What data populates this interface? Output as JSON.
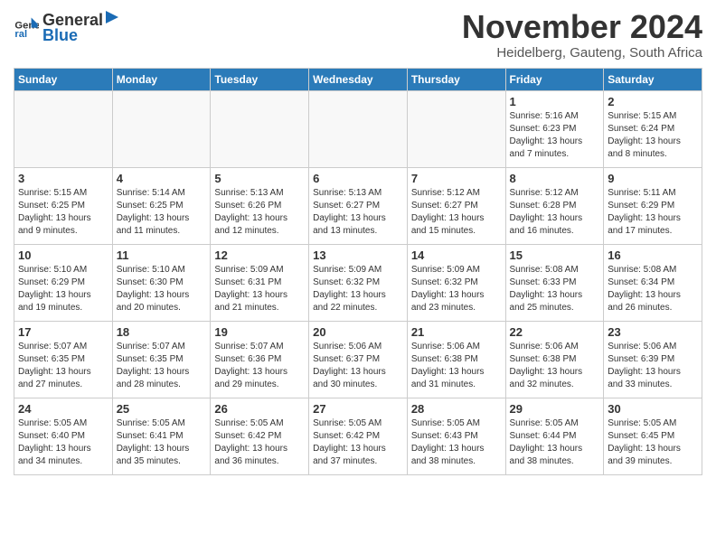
{
  "header": {
    "logo_general": "General",
    "logo_blue": "Blue",
    "month_title": "November 2024",
    "location": "Heidelberg, Gauteng, South Africa"
  },
  "weekdays": [
    "Sunday",
    "Monday",
    "Tuesday",
    "Wednesday",
    "Thursday",
    "Friday",
    "Saturday"
  ],
  "weeks": [
    [
      {
        "day": "",
        "info": ""
      },
      {
        "day": "",
        "info": ""
      },
      {
        "day": "",
        "info": ""
      },
      {
        "day": "",
        "info": ""
      },
      {
        "day": "",
        "info": ""
      },
      {
        "day": "1",
        "info": "Sunrise: 5:16 AM\nSunset: 6:23 PM\nDaylight: 13 hours and 7 minutes."
      },
      {
        "day": "2",
        "info": "Sunrise: 5:15 AM\nSunset: 6:24 PM\nDaylight: 13 hours and 8 minutes."
      }
    ],
    [
      {
        "day": "3",
        "info": "Sunrise: 5:15 AM\nSunset: 6:25 PM\nDaylight: 13 hours and 9 minutes."
      },
      {
        "day": "4",
        "info": "Sunrise: 5:14 AM\nSunset: 6:25 PM\nDaylight: 13 hours and 11 minutes."
      },
      {
        "day": "5",
        "info": "Sunrise: 5:13 AM\nSunset: 6:26 PM\nDaylight: 13 hours and 12 minutes."
      },
      {
        "day": "6",
        "info": "Sunrise: 5:13 AM\nSunset: 6:27 PM\nDaylight: 13 hours and 13 minutes."
      },
      {
        "day": "7",
        "info": "Sunrise: 5:12 AM\nSunset: 6:27 PM\nDaylight: 13 hours and 15 minutes."
      },
      {
        "day": "8",
        "info": "Sunrise: 5:12 AM\nSunset: 6:28 PM\nDaylight: 13 hours and 16 minutes."
      },
      {
        "day": "9",
        "info": "Sunrise: 5:11 AM\nSunset: 6:29 PM\nDaylight: 13 hours and 17 minutes."
      }
    ],
    [
      {
        "day": "10",
        "info": "Sunrise: 5:10 AM\nSunset: 6:29 PM\nDaylight: 13 hours and 19 minutes."
      },
      {
        "day": "11",
        "info": "Sunrise: 5:10 AM\nSunset: 6:30 PM\nDaylight: 13 hours and 20 minutes."
      },
      {
        "day": "12",
        "info": "Sunrise: 5:09 AM\nSunset: 6:31 PM\nDaylight: 13 hours and 21 minutes."
      },
      {
        "day": "13",
        "info": "Sunrise: 5:09 AM\nSunset: 6:32 PM\nDaylight: 13 hours and 22 minutes."
      },
      {
        "day": "14",
        "info": "Sunrise: 5:09 AM\nSunset: 6:32 PM\nDaylight: 13 hours and 23 minutes."
      },
      {
        "day": "15",
        "info": "Sunrise: 5:08 AM\nSunset: 6:33 PM\nDaylight: 13 hours and 25 minutes."
      },
      {
        "day": "16",
        "info": "Sunrise: 5:08 AM\nSunset: 6:34 PM\nDaylight: 13 hours and 26 minutes."
      }
    ],
    [
      {
        "day": "17",
        "info": "Sunrise: 5:07 AM\nSunset: 6:35 PM\nDaylight: 13 hours and 27 minutes."
      },
      {
        "day": "18",
        "info": "Sunrise: 5:07 AM\nSunset: 6:35 PM\nDaylight: 13 hours and 28 minutes."
      },
      {
        "day": "19",
        "info": "Sunrise: 5:07 AM\nSunset: 6:36 PM\nDaylight: 13 hours and 29 minutes."
      },
      {
        "day": "20",
        "info": "Sunrise: 5:06 AM\nSunset: 6:37 PM\nDaylight: 13 hours and 30 minutes."
      },
      {
        "day": "21",
        "info": "Sunrise: 5:06 AM\nSunset: 6:38 PM\nDaylight: 13 hours and 31 minutes."
      },
      {
        "day": "22",
        "info": "Sunrise: 5:06 AM\nSunset: 6:38 PM\nDaylight: 13 hours and 32 minutes."
      },
      {
        "day": "23",
        "info": "Sunrise: 5:06 AM\nSunset: 6:39 PM\nDaylight: 13 hours and 33 minutes."
      }
    ],
    [
      {
        "day": "24",
        "info": "Sunrise: 5:05 AM\nSunset: 6:40 PM\nDaylight: 13 hours and 34 minutes."
      },
      {
        "day": "25",
        "info": "Sunrise: 5:05 AM\nSunset: 6:41 PM\nDaylight: 13 hours and 35 minutes."
      },
      {
        "day": "26",
        "info": "Sunrise: 5:05 AM\nSunset: 6:42 PM\nDaylight: 13 hours and 36 minutes."
      },
      {
        "day": "27",
        "info": "Sunrise: 5:05 AM\nSunset: 6:42 PM\nDaylight: 13 hours and 37 minutes."
      },
      {
        "day": "28",
        "info": "Sunrise: 5:05 AM\nSunset: 6:43 PM\nDaylight: 13 hours and 38 minutes."
      },
      {
        "day": "29",
        "info": "Sunrise: 5:05 AM\nSunset: 6:44 PM\nDaylight: 13 hours and 38 minutes."
      },
      {
        "day": "30",
        "info": "Sunrise: 5:05 AM\nSunset: 6:45 PM\nDaylight: 13 hours and 39 minutes."
      }
    ]
  ]
}
